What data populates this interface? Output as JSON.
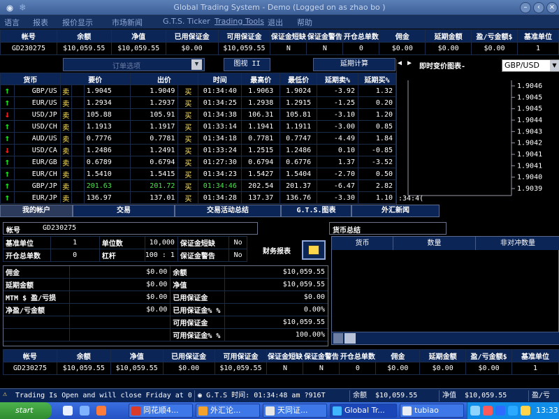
{
  "window": {
    "title": "Global Trading System  -  Demo (Logged on as zhao bo )",
    "logo": "globe-icon"
  },
  "menu": {
    "items": [
      "语言",
      "报表",
      "报价显示",
      "市场新闻",
      "G.T.S. Ticker",
      "Trading Tools",
      "退出",
      "帮助"
    ]
  },
  "account_summary": {
    "headers": [
      "帐号",
      "余额",
      "净值",
      "已用保证金",
      "可用保证金",
      "保证金短缺",
      "保证金警告",
      "开仓总单数",
      "佣金",
      "延期金额",
      "盈/亏金额$",
      "基准单位"
    ],
    "values": [
      "GD230275",
      "$10,059.55",
      "$10,059.55",
      "$0.00",
      "$10,059.55",
      "N",
      "N",
      "0",
      "$0.00",
      "$0.00",
      "$0.00",
      "1"
    ]
  },
  "controls": {
    "order_options": "订单选项",
    "graph_view": "图视 II",
    "rollover_calc": "延期计算"
  },
  "rates": {
    "headers": [
      "货币",
      "要价",
      "出价",
      "时间",
      "最高价",
      "最低价",
      "延期卖%",
      "延期买%"
    ],
    "sell_label": "卖",
    "buy_label": "买",
    "rows": [
      {
        "dir": "up",
        "pair": "GBP/US",
        "bid": "1.9045",
        "ask": "1.9049",
        "time": "01:34:40",
        "high": "1.9063",
        "low": "1.9024",
        "sell_roll": "-3.92",
        "buy_roll": "1.32",
        "hl": false
      },
      {
        "dir": "up",
        "pair": "EUR/US",
        "bid": "1.2934",
        "ask": "1.2937",
        "time": "01:34:25",
        "high": "1.2938",
        "low": "1.2915",
        "sell_roll": "-1.25",
        "buy_roll": "0.20",
        "hl": false
      },
      {
        "dir": "dn",
        "pair": "USD/JP",
        "bid": "105.88",
        "ask": "105.91",
        "time": "01:34:38",
        "high": "106.31",
        "low": "105.81",
        "sell_roll": "-3.10",
        "buy_roll": "1.20",
        "hl": false
      },
      {
        "dir": "up",
        "pair": "USD/CH",
        "bid": "1.1913",
        "ask": "1.1917",
        "time": "01:33:14",
        "high": "1.1941",
        "low": "1.1911",
        "sell_roll": "-3.00",
        "buy_roll": "0.85",
        "hl": false
      },
      {
        "dir": "up",
        "pair": "AUD/US",
        "bid": "0.7776",
        "ask": "0.7781",
        "time": "01:34:18",
        "high": "0.7781",
        "low": "0.7747",
        "sell_roll": "-4.49",
        "buy_roll": "1.84",
        "hl": false
      },
      {
        "dir": "dn",
        "pair": "USD/CA",
        "bid": "1.2486",
        "ask": "1.2491",
        "time": "01:33:24",
        "high": "1.2515",
        "low": "1.2486",
        "sell_roll": "0.10",
        "buy_roll": "-0.85",
        "hl": false
      },
      {
        "dir": "up",
        "pair": "EUR/GB",
        "bid": "0.6789",
        "ask": "0.6794",
        "time": "01:27:30",
        "high": "0.6794",
        "low": "0.6776",
        "sell_roll": "1.37",
        "buy_roll": "-3.52",
        "hl": false
      },
      {
        "dir": "up",
        "pair": "EUR/CH",
        "bid": "1.5410",
        "ask": "1.5415",
        "time": "01:34:23",
        "high": "1.5427",
        "low": "1.5404",
        "sell_roll": "-2.70",
        "buy_roll": "0.50",
        "hl": false
      },
      {
        "dir": "up",
        "pair": "GBP/JP",
        "bid": "201.63",
        "ask": "201.72",
        "time": "01:34:46",
        "high": "202.54",
        "low": "201.37",
        "sell_roll": "-6.47",
        "buy_roll": "2.82",
        "hl": true
      },
      {
        "dir": "up",
        "pair": "EUR/JP",
        "bid": "136.97",
        "ask": "137.01",
        "time": "01:34:28",
        "high": "137.37",
        "low": "136.76",
        "sell_roll": "-3.30",
        "buy_roll": "1.10",
        "hl": false
      }
    ]
  },
  "live_chart": {
    "title": "即时变价图表-",
    "symbol": "GBP/USD",
    "yticks": [
      "1.9046",
      "1.9045",
      "1.9045",
      "1.9044",
      "1.9043",
      "1.9042",
      "1.9041",
      "1.9041",
      "1.9040",
      "1.9039"
    ],
    "xtick": ":34:4("
  },
  "lower_tabs": [
    "我的帐户",
    "交易",
    "交易活动总结",
    "G.T.S.图表",
    "外汇新闻"
  ],
  "my_account": {
    "acct_label": "帐号",
    "acct_value": "GD230275",
    "base_unit_label": "基准单位",
    "base_unit_value": "1",
    "lots_label": "单位数",
    "lots_value": "10,000",
    "margin_short_label": "保证金短缺",
    "margin_short_value": "No",
    "open_orders_label": "开仓总单数",
    "open_orders_value": "0",
    "leverage_label": "杠杆",
    "leverage_value": "100 : 1",
    "margin_warn_label": "保证金警告",
    "margin_warn_value": "No",
    "report_label": "财务报表",
    "left_rows": [
      {
        "label": "佣金",
        "value": "$0.00"
      },
      {
        "label": "延期金额",
        "value": "$0.00"
      },
      {
        "label": "MTM $ 盈/亏损",
        "value": "$0.00"
      },
      {
        "label": "净盈/亏金额",
        "value": "$0.00"
      }
    ],
    "right_rows": [
      {
        "label": "余额",
        "value": "$10,059.55"
      },
      {
        "label": "净值",
        "value": "$10,059.55"
      },
      {
        "label": "已用保证金",
        "value": "$0.00"
      },
      {
        "label": "已用保证金% %",
        "value": "0.00%"
      },
      {
        "label": "可用保证金",
        "value": "$10,059.55"
      },
      {
        "label": "可用保证金% %",
        "value": "100.00%"
      }
    ]
  },
  "currency_summary": {
    "title": "货币总结",
    "headers": [
      "货币",
      "数量",
      "非对冲数量"
    ]
  },
  "status": {
    "message": "Trading Is Open and will close Friday at 0",
    "gts_time_label": "G.T.S 时间:",
    "gts_time": "01:34:48 am ?916T",
    "balance_label": "余额",
    "balance": "$10,059.55",
    "equity_label": "净值",
    "equity": "$10,059.55",
    "pnl_label": "盈/亏"
  },
  "taskbar": {
    "start": "start",
    "tasks": [
      "同花顺4...",
      "外汇论...",
      "天同证...",
      "Global Tr...",
      "tubiao"
    ],
    "clock": "13:33"
  }
}
